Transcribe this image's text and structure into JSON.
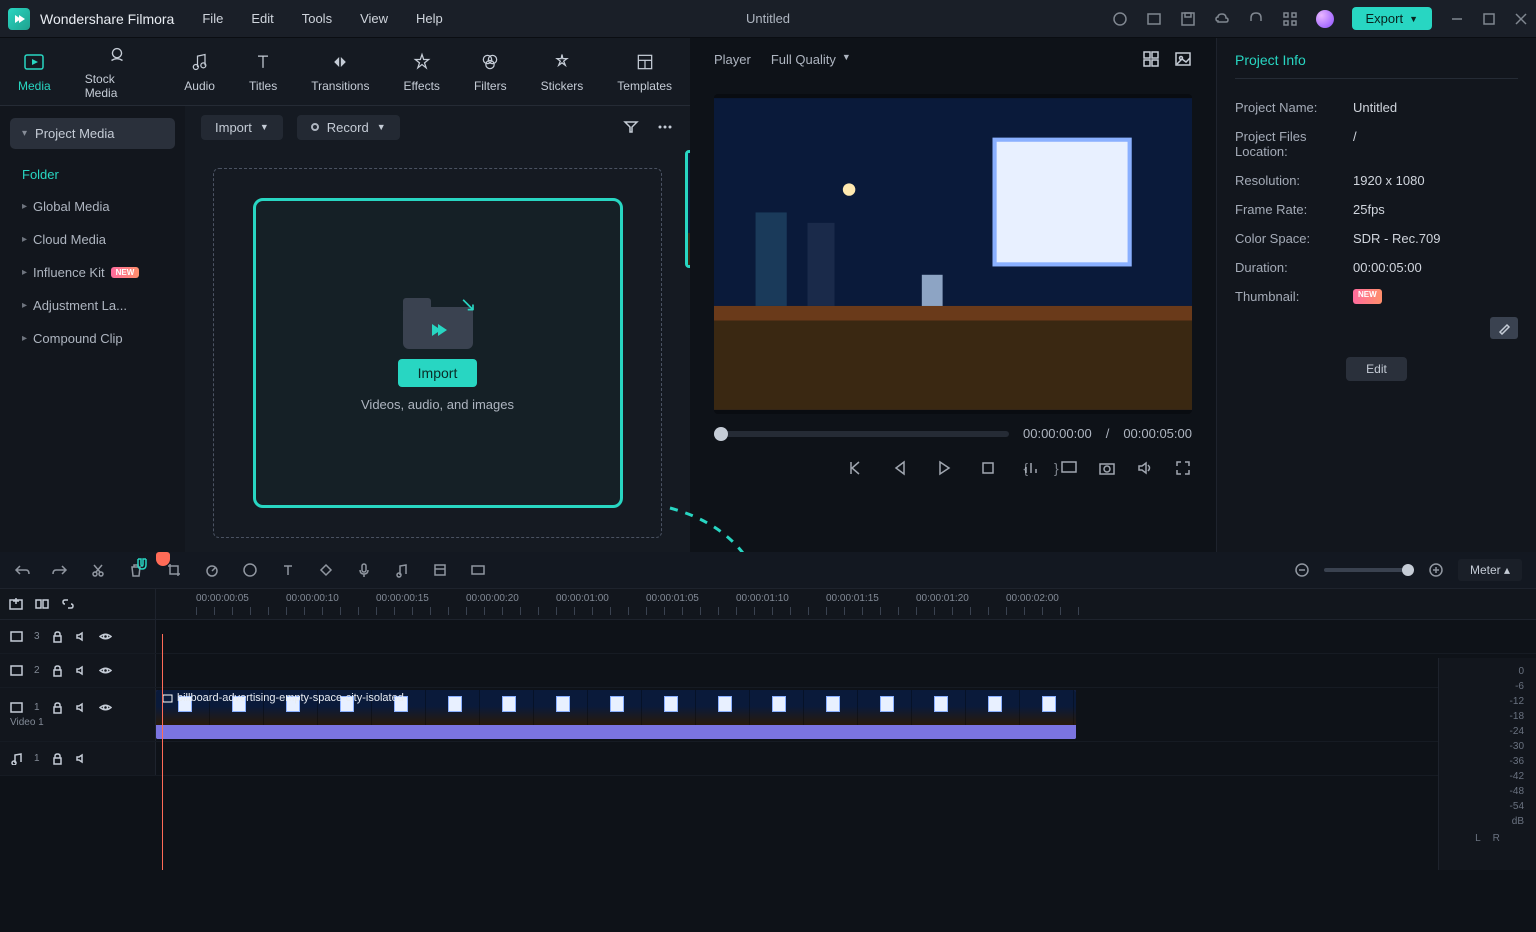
{
  "app": {
    "name": "Wondershare Filmora"
  },
  "menu": [
    "File",
    "Edit",
    "Tools",
    "View",
    "Help"
  ],
  "window": {
    "title": "Untitled",
    "export": "Export"
  },
  "tabs": [
    {
      "label": "Media",
      "icon": "media-icon",
      "active": true
    },
    {
      "label": "Stock Media",
      "icon": "stock-icon"
    },
    {
      "label": "Audio",
      "icon": "audio-icon"
    },
    {
      "label": "Titles",
      "icon": "titles-icon"
    },
    {
      "label": "Transitions",
      "icon": "transitions-icon"
    },
    {
      "label": "Effects",
      "icon": "effects-icon"
    },
    {
      "label": "Filters",
      "icon": "filters-icon"
    },
    {
      "label": "Stickers",
      "icon": "stickers-icon"
    },
    {
      "label": "Templates",
      "icon": "templates-icon"
    }
  ],
  "sidebar": {
    "header": "Project Media",
    "folder": "Folder",
    "items": [
      {
        "label": "Global Media"
      },
      {
        "label": "Cloud Media"
      },
      {
        "label": "Influence Kit",
        "new": true
      },
      {
        "label": "Adjustment La..."
      },
      {
        "label": "Compound Clip"
      }
    ]
  },
  "mediabar": {
    "import": "Import",
    "record": "Record"
  },
  "dropzone": {
    "button": "Import",
    "caption": "Videos, audio, and images"
  },
  "player": {
    "label": "Player",
    "quality": "Full Quality",
    "cur": "00:00:00:00",
    "sep": "/",
    "dur": "00:00:05:00",
    "markerL": "{",
    "markerR": "}"
  },
  "projectinfo": {
    "title": "Project Info",
    "rows": [
      {
        "k": "Project Name:",
        "v": "Untitled"
      },
      {
        "k": "Project Files Location:",
        "v": "/"
      },
      {
        "k": "Resolution:",
        "v": "1920 x 1080"
      },
      {
        "k": "Frame Rate:",
        "v": "25fps"
      },
      {
        "k": "Color Space:",
        "v": "SDR - Rec.709"
      },
      {
        "k": "Duration:",
        "v": "00:00:05:00"
      }
    ],
    "thumbnail": "Thumbnail:",
    "edit": "Edit"
  },
  "timeline": {
    "meter": "Meter",
    "ticks": [
      "00:00:00:05",
      "00:00:00:10",
      "00:00:00:15",
      "00:00:00:20",
      "00:00:01:00",
      "00:00:01:05",
      "00:00:01:10",
      "00:00:01:15",
      "00:00:01:20",
      "00:00:02:00"
    ],
    "tracks": [
      {
        "id": "3",
        "type": "video"
      },
      {
        "id": "2",
        "type": "video"
      },
      {
        "id": "1",
        "type": "video",
        "label": "Video 1",
        "clip": "billboard-advertising-empty-space-city-isolated"
      },
      {
        "id": "1",
        "type": "audio"
      }
    ],
    "db": [
      "0",
      "-6",
      "-12",
      "-18",
      "-24",
      "-30",
      "-36",
      "-42",
      "-48",
      "-54",
      "dB"
    ],
    "lr": [
      "L",
      "R"
    ]
  }
}
